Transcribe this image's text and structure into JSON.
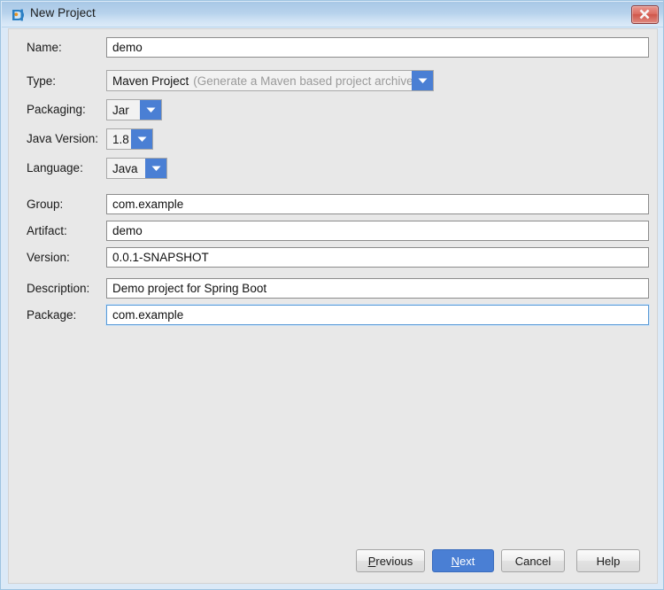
{
  "window": {
    "title": "New Project",
    "icon": "spring-boot-wizard-icon",
    "close_icon": "close-icon",
    "accent_blue": "#4a7fd4",
    "titlebar_blue": "#b7d2ec",
    "content_bg": "#e8e8e8",
    "close_red": "#cf564a"
  },
  "form": {
    "fields": [
      {
        "label": "Name:",
        "name": "name",
        "kind": "text",
        "value": "demo"
      },
      {
        "label": "Type:",
        "name": "type",
        "kind": "combo",
        "value": "Maven Project",
        "hint": "(Generate a Maven based project archive)"
      },
      {
        "label": "Packaging:",
        "name": "packaging",
        "kind": "combo",
        "value": "Jar"
      },
      {
        "label": "Java Version:",
        "name": "java-version",
        "kind": "combo",
        "value": "1.8"
      },
      {
        "label": "Language:",
        "name": "language",
        "kind": "combo",
        "value": "Java"
      },
      {
        "label": "Group:",
        "name": "group",
        "kind": "text",
        "value": "com.example"
      },
      {
        "label": "Artifact:",
        "name": "artifact",
        "kind": "text",
        "value": "demo"
      },
      {
        "label": "Version:",
        "name": "version",
        "kind": "text",
        "value": "0.0.1-SNAPSHOT"
      },
      {
        "label": "Description:",
        "name": "description",
        "kind": "text",
        "value": "Demo project for Spring Boot"
      },
      {
        "label": "Package:",
        "name": "package",
        "kind": "text",
        "value": "com.example",
        "focused": true
      }
    ]
  },
  "footer": {
    "buttons": [
      {
        "name": "previous",
        "label": "Previous",
        "mnemonic": "P",
        "primary": false
      },
      {
        "name": "next",
        "label": "Next",
        "mnemonic": "N",
        "primary": true
      },
      {
        "name": "cancel",
        "label": "Cancel",
        "mnemonic": "",
        "primary": false
      },
      {
        "name": "help",
        "label": "Help",
        "mnemonic": "",
        "primary": false
      }
    ]
  }
}
